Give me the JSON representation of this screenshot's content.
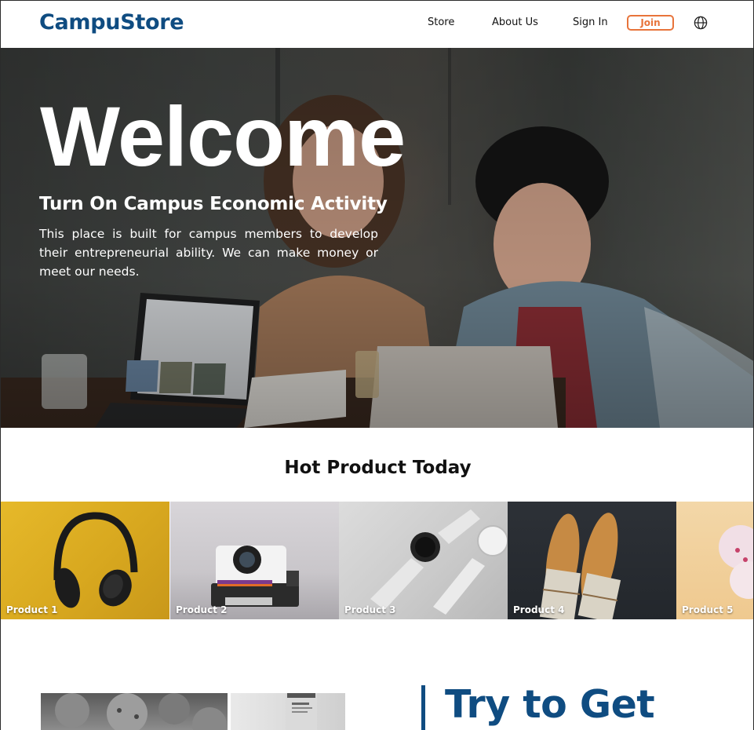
{
  "header": {
    "logo": "CampuStore",
    "nav": {
      "store": "Store",
      "about": "About Us",
      "signin": "Sign In",
      "join": "Join"
    },
    "language_icon": "globe-icon"
  },
  "hero": {
    "title": "Welcome",
    "subtitle": "Turn On Campus Economic Activity",
    "description": "This place is built for campus members to develop their entrepreneurial ability. We can make money or meet our needs."
  },
  "hot_products": {
    "title": "Hot Product Today",
    "items": [
      {
        "label": "Product 1",
        "image": "headphones"
      },
      {
        "label": "Product 2",
        "image": "instant-camera"
      },
      {
        "label": "Product 3",
        "image": "smartwatches"
      },
      {
        "label": "Product 4",
        "image": "baguettes"
      },
      {
        "label": "Product 5",
        "image": "ice-cream"
      }
    ]
  },
  "promo": {
    "title": "Try to Get"
  },
  "colors": {
    "brand": "#0f4c81",
    "join_accent": "#e8743b"
  }
}
